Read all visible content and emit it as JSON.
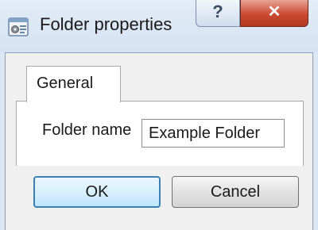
{
  "window": {
    "title": "Folder properties",
    "help_label": "?",
    "close_label": "✕"
  },
  "tabs": [
    {
      "label": "General",
      "selected": true
    }
  ],
  "form": {
    "folder_name_label": "Folder name",
    "folder_name_value": "Example Folder"
  },
  "buttons": {
    "ok_label": "OK",
    "cancel_label": "Cancel"
  },
  "colors": {
    "accent": "#3c7fb1",
    "close_button": "#c94a33",
    "window_frame": "#dbe6f3"
  },
  "icons": {
    "app_icon": "folder-properties-icon"
  }
}
